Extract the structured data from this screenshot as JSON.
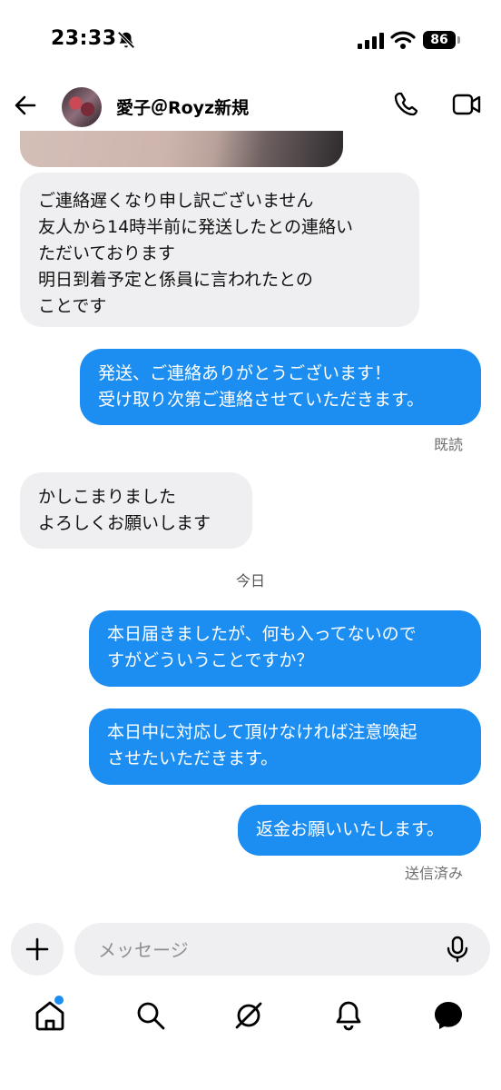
{
  "status_bar": {
    "time": "23:33",
    "battery": "86"
  },
  "header": {
    "contact_name": "愛子＠Royz新規"
  },
  "messages": [
    {
      "from": "contact",
      "text": "ご連絡遅くなり申し訳ございません\n友人から14時半前に発送したとの連絡い\nただいております\n明日到着予定と係員に言われたとの\nことです"
    },
    {
      "from": "me",
      "text": "発送、ご連絡ありがとうございます！\n受け取り次第ご連絡させていただきます。"
    },
    {
      "from": "contact",
      "text": "かしこまりました\nよろしくお願いします"
    },
    {
      "from": "me",
      "text": "本日届きましたが、何も入ってないので\nすがどういうことですか？"
    },
    {
      "from": "me",
      "text": "本日中に対応して頂けなければ注意喚起\nさせたいただきます。"
    },
    {
      "from": "me",
      "text": "返金お願いいたします。"
    }
  ],
  "labels": {
    "read": "既読",
    "date_separator": "今日",
    "sent": "送信済み"
  },
  "composer": {
    "placeholder": "メッセージ"
  },
  "bottom_nav": [
    "home-icon",
    "search-icon",
    "explore-icon",
    "notifications-icon",
    "messages-icon"
  ],
  "colors": {
    "outgoing_bubble": "#1d8ef1",
    "incoming_bubble": "#efeff1"
  }
}
